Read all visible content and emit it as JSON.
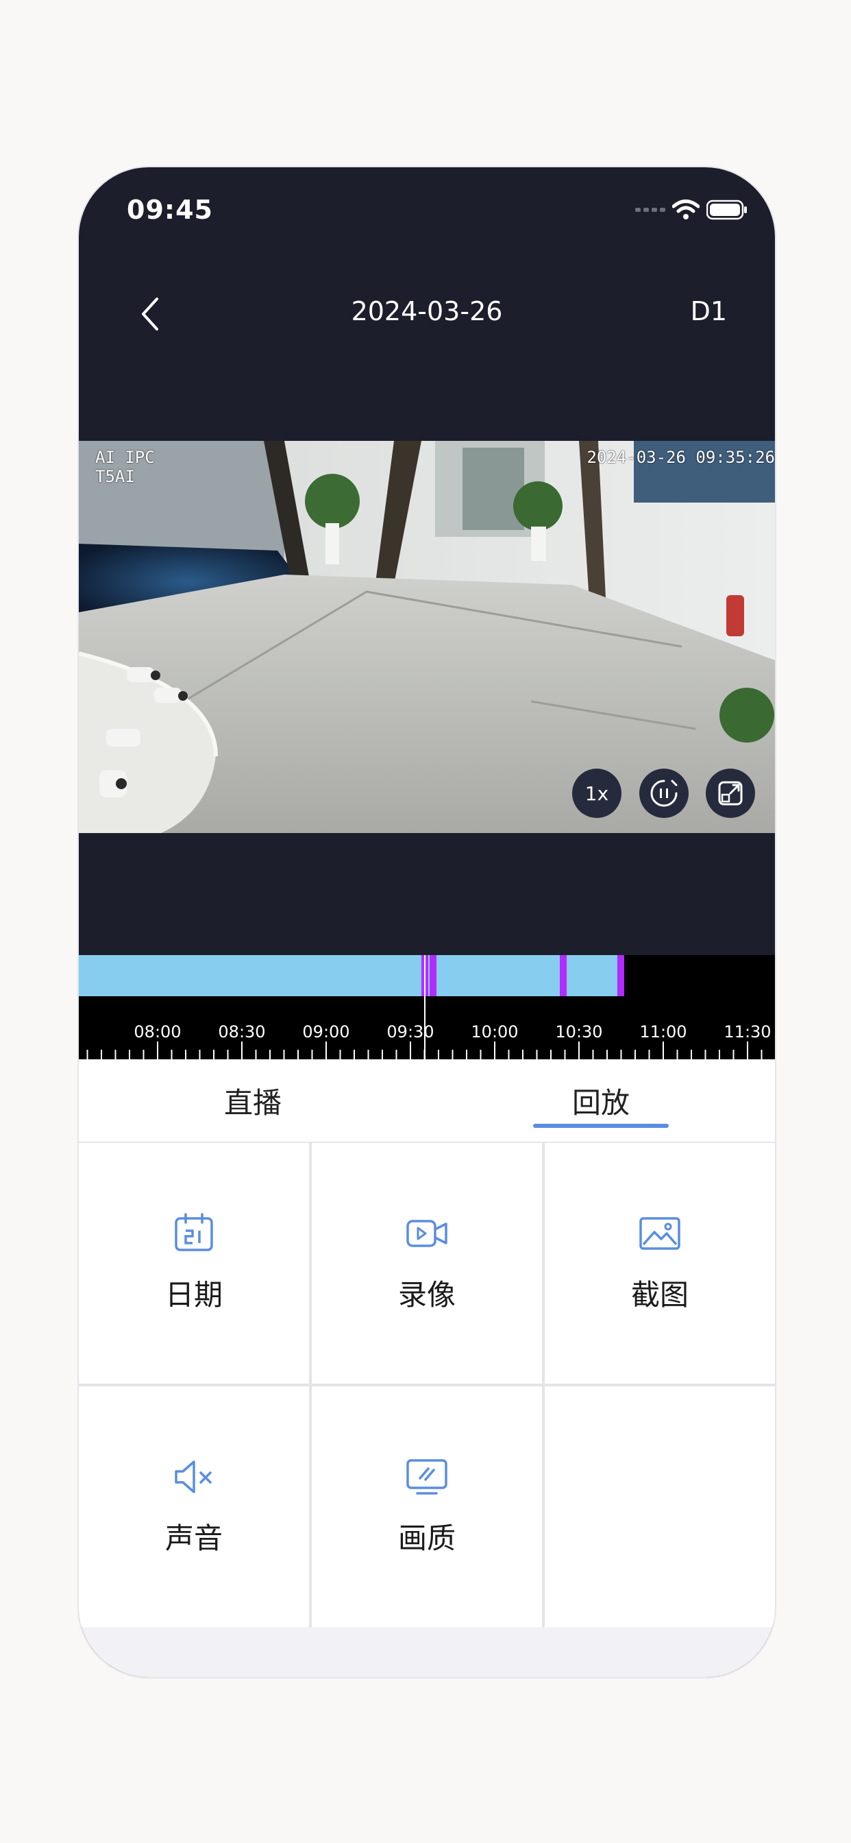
{
  "status_bar": {
    "time": "09:45"
  },
  "nav": {
    "title": "2024-03-26",
    "device": "D1"
  },
  "video": {
    "osd_line1": "AI IPC",
    "osd_line2": "T5AI",
    "osd_timestamp": "2024-03-26 09:35:26",
    "speed_label": "1x"
  },
  "timeline": {
    "ticks": [
      "08:00",
      "08:30",
      "09:00",
      "09:30",
      "10:00",
      "10:30",
      "11:00",
      "11:30"
    ]
  },
  "tabs": {
    "live": "直播",
    "playback": "回放",
    "active": "playback"
  },
  "actions": {
    "date": "日期",
    "record": "录像",
    "screenshot": "截图",
    "sound": "声音",
    "quality": "画质"
  },
  "colors": {
    "accent": "#5a8de0",
    "recording": "#87cdf0",
    "event_marker": "#b12cff",
    "background": "#1d1e2c"
  }
}
